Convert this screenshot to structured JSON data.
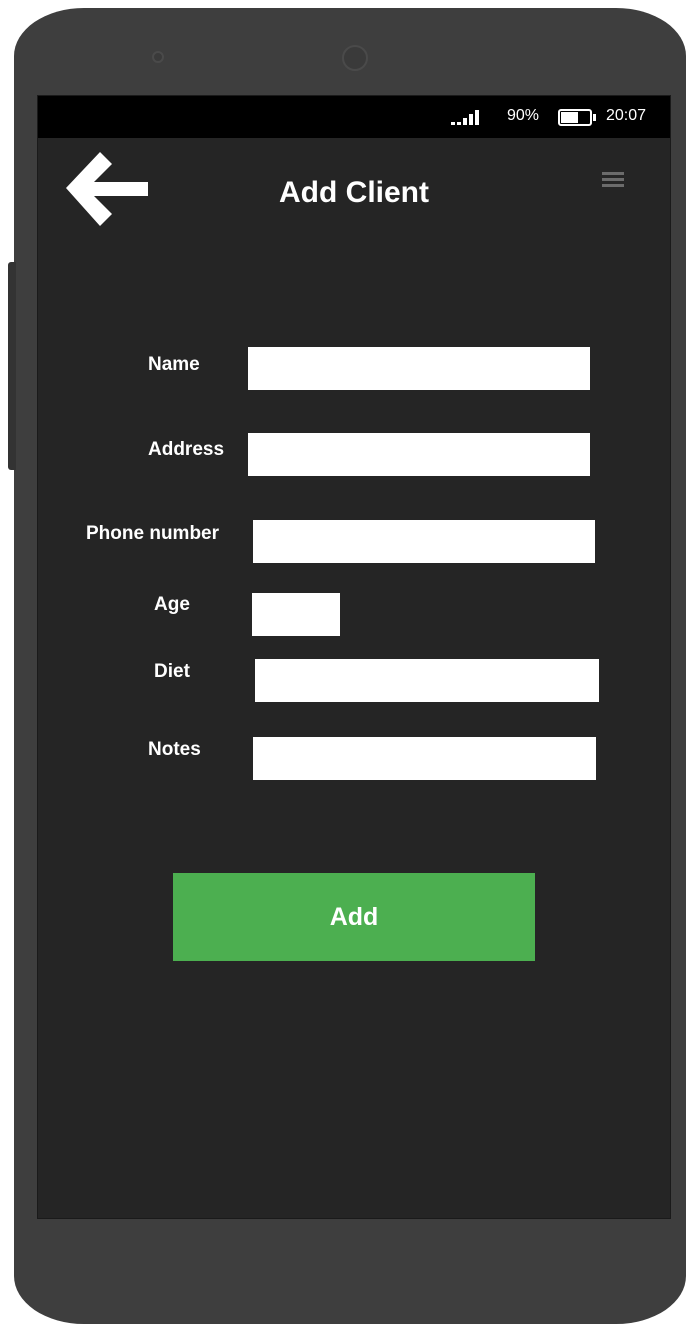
{
  "status_bar": {
    "battery_percent": "90%",
    "battery_level": 0.65,
    "time": "20:07",
    "icons": {
      "signal": "signal-bars-icon",
      "battery": "battery-icon"
    }
  },
  "header": {
    "title": "Add Client",
    "back_icon": "arrow-left-icon",
    "menu_icon": "hamburger-menu-icon"
  },
  "form": {
    "fields": [
      {
        "label": "Name",
        "value": "",
        "placeholder": ""
      },
      {
        "label": "Address",
        "value": "",
        "placeholder": ""
      },
      {
        "label": "Phone number",
        "value": "",
        "placeholder": ""
      },
      {
        "label": "Age",
        "value": "",
        "placeholder": ""
      },
      {
        "label": "Diet",
        "value": "",
        "placeholder": ""
      },
      {
        "label": "Notes",
        "value": "",
        "placeholder": ""
      }
    ],
    "submit_label": "Add"
  },
  "colors": {
    "screen_background": "#252525",
    "phone_body": "#3e3e3e",
    "status_bar": "#000000",
    "input_background": "#ffffff",
    "accent_green": "#4caf50",
    "text": "#ffffff"
  }
}
